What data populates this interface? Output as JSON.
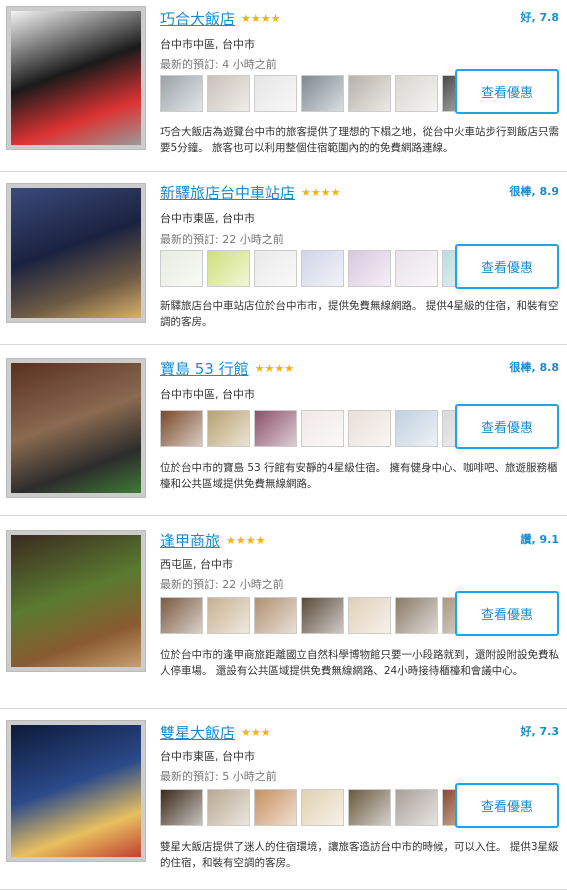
{
  "hotels": [
    {
      "name": "巧合大飯店",
      "stars": "★★★★",
      "rating": "好, 7.8",
      "location": "台中市中區, 台中市",
      "recent": "最新的預訂: 4 小時之前",
      "deal_label": "查看優惠",
      "description": "巧合大飯店為遊覽台中市的旅客提供了理想的下榻之地，從台中火車站步行到飯店只需要5分鐘。 旅客也可以利用整個住宿範圍內的的免費網路連線。",
      "thumb_colors": [
        "#f4f4f4",
        "#1a1a1a",
        "#d33",
        "#999"
      ],
      "photo_colors": [
        "#9aa3a8",
        "#c8c2b8",
        "#e6e6e6",
        "#7d8a90",
        "#b7b2a8",
        "#d8d6d0",
        "#4a4a4a"
      ]
    },
    {
      "name": "新驛旅店台中車站店",
      "stars": "★★★★",
      "rating": "很棒, 8.9",
      "location": "台中市東區, 台中市",
      "recent": "最新的預訂: 22 小時之前",
      "deal_label": "查看優惠",
      "description": "新驛旅店台中車站店位於台中市市，提供免費無線網路。 提供4星級的住宿，和裝有空調的客房。",
      "thumb_colors": [
        "#3b4a7a",
        "#1b2240",
        "#6d5a44",
        "#d9b06a"
      ],
      "photo_colors": [
        "#e8ece0",
        "#cfe07a",
        "#eaeaea",
        "#d0d4e8",
        "#d8c7e0",
        "#e9e2e8",
        "#bdd"
      ]
    },
    {
      "name": "寶島 53 行館",
      "stars": "★★★★",
      "rating": "很棒, 8.8",
      "location": "台中市中區, 台中市",
      "recent": "",
      "deal_label": "查看優惠",
      "description": "位於台中市的寶島 53 行館有安靜的4星級住宿。 擁有健身中心、咖啡吧、旅遊服務櫃檯和公共區域提供免費無線網路。",
      "thumb_colors": [
        "#5a3020",
        "#8a6a50",
        "#2c2c2c",
        "#3f7a35"
      ],
      "photo_colors": [
        "#7a4a2a",
        "#b8a070",
        "#8a5068",
        "#f0e8e8",
        "#e8e0d8",
        "#c0d0e0",
        "#d8d8d8"
      ]
    },
    {
      "name": "逢甲商旅",
      "stars": "★★★★",
      "rating": "讚, 9.1",
      "location": "西屯區, 台中市",
      "recent": "最新的預訂: 22 小時之前",
      "deal_label": "查看優惠",
      "description": "位於台中市的逢甲商旅距離國立自然科學博物館只要一小段路就到，還附設附設免費私人停車場。 還設有公共區域提供免費無線網路、24小時接待櫃檯和會議中心。",
      "thumb_colors": [
        "#3a2a20",
        "#5a7a30",
        "#8a5a30",
        "#c8a070"
      ],
      "photo_colors": [
        "#7a5a40",
        "#c8b090",
        "#b09070",
        "#5a4a3a",
        "#e0d0b8",
        "#8a7a68",
        "#a89880"
      ]
    },
    {
      "name": "雙星大飯店",
      "stars": "★★★",
      "rating": "好, 7.3",
      "location": "台中市東區, 台中市",
      "recent": "最新的預訂: 5 小時之前",
      "deal_label": "查看優惠",
      "description": "雙星大飯店提供了迷人的住宿環境，讓旅客造訪台中市的時候，可以入住。 提供3星級的住宿，和裝有空調的客房。",
      "thumb_colors": [
        "#0d1a3a",
        "#2a4a8a",
        "#e8c060",
        "#c04030"
      ],
      "photo_colors": [
        "#3a2a1a",
        "#b8a890",
        "#c89060",
        "#e0d0b0",
        "#6a5a40",
        "#a8a098",
        "#8a4a30"
      ]
    }
  ]
}
